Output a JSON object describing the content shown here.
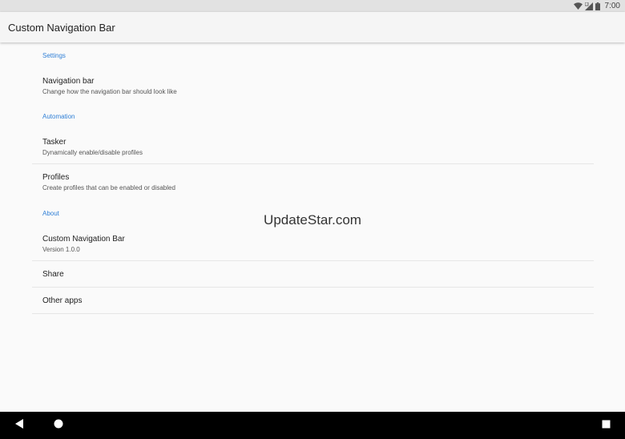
{
  "status_bar": {
    "time": "7:00",
    "icons": [
      "wifi-icon",
      "signal-icon",
      "battery-icon"
    ]
  },
  "toolbar": {
    "title": "Custom Navigation Bar"
  },
  "settings": {
    "categories": [
      "Settings",
      "Automation",
      "About"
    ],
    "navigation_bar": {
      "title": "Navigation bar",
      "summary": "Change how the navigation bar should look like"
    },
    "tasker": {
      "title": "Tasker",
      "summary": "Dynamically enable/disable profiles"
    },
    "profiles": {
      "title": "Profiles",
      "summary": "Create profiles that can be enabled or disabled"
    },
    "about_app": {
      "title": "Custom Navigation Bar",
      "summary": "Version 1.0.0"
    },
    "share": {
      "title": "Share"
    },
    "other_apps": {
      "title": "Other apps"
    }
  },
  "watermark": "UpdateStar.com",
  "nav_bar": {
    "buttons": [
      "back-icon",
      "home-icon",
      "recents-icon"
    ]
  },
  "colors": {
    "accent": "#2f7fd6",
    "status_bar": "#e2e2e2",
    "toolbar": "#f5f5f5",
    "background": "#fafafa",
    "nav_bar": "#000000"
  }
}
